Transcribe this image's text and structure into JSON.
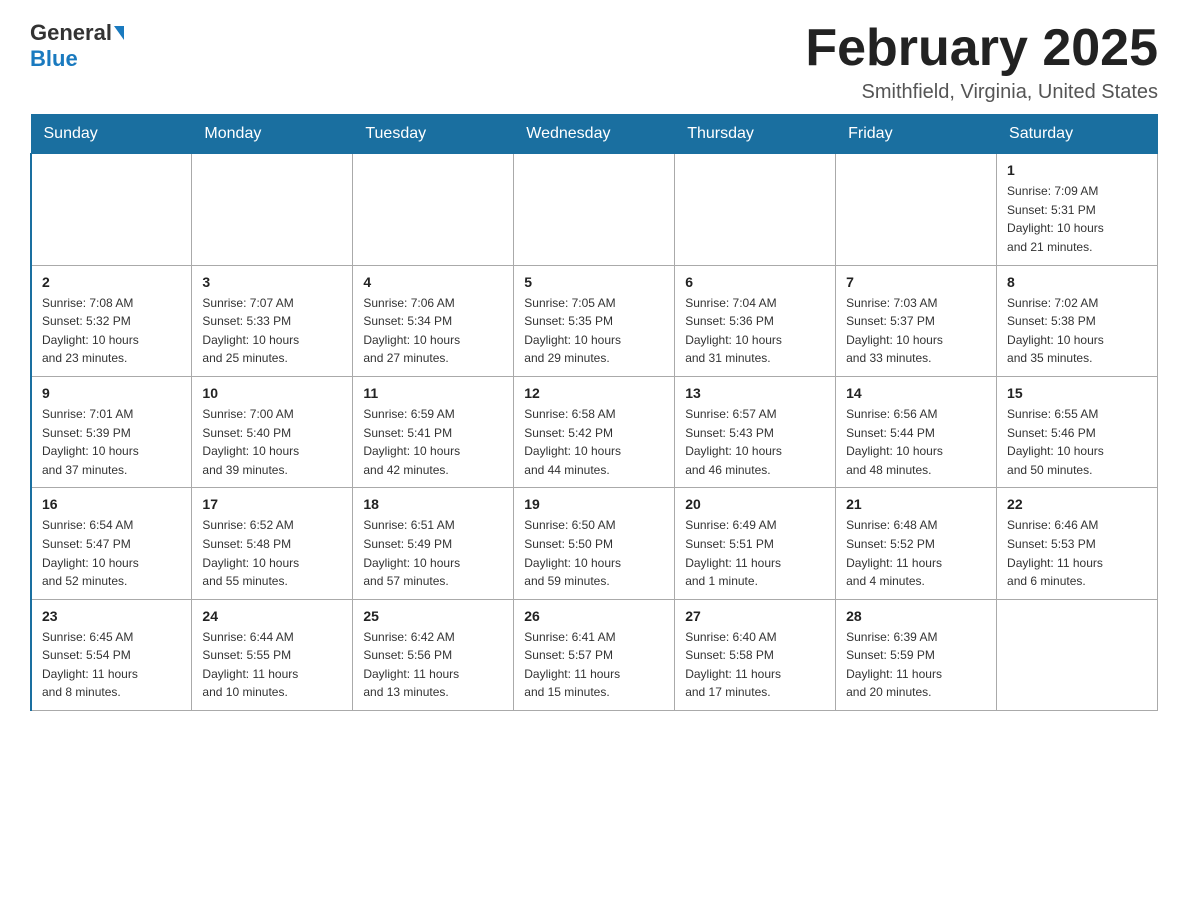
{
  "header": {
    "logo_general": "General",
    "logo_blue": "Blue",
    "month_title": "February 2025",
    "location": "Smithfield, Virginia, United States"
  },
  "days_of_week": [
    "Sunday",
    "Monday",
    "Tuesday",
    "Wednesday",
    "Thursday",
    "Friday",
    "Saturday"
  ],
  "weeks": [
    [
      {
        "day": "",
        "info": ""
      },
      {
        "day": "",
        "info": ""
      },
      {
        "day": "",
        "info": ""
      },
      {
        "day": "",
        "info": ""
      },
      {
        "day": "",
        "info": ""
      },
      {
        "day": "",
        "info": ""
      },
      {
        "day": "1",
        "info": "Sunrise: 7:09 AM\nSunset: 5:31 PM\nDaylight: 10 hours\nand 21 minutes."
      }
    ],
    [
      {
        "day": "2",
        "info": "Sunrise: 7:08 AM\nSunset: 5:32 PM\nDaylight: 10 hours\nand 23 minutes."
      },
      {
        "day": "3",
        "info": "Sunrise: 7:07 AM\nSunset: 5:33 PM\nDaylight: 10 hours\nand 25 minutes."
      },
      {
        "day": "4",
        "info": "Sunrise: 7:06 AM\nSunset: 5:34 PM\nDaylight: 10 hours\nand 27 minutes."
      },
      {
        "day": "5",
        "info": "Sunrise: 7:05 AM\nSunset: 5:35 PM\nDaylight: 10 hours\nand 29 minutes."
      },
      {
        "day": "6",
        "info": "Sunrise: 7:04 AM\nSunset: 5:36 PM\nDaylight: 10 hours\nand 31 minutes."
      },
      {
        "day": "7",
        "info": "Sunrise: 7:03 AM\nSunset: 5:37 PM\nDaylight: 10 hours\nand 33 minutes."
      },
      {
        "day": "8",
        "info": "Sunrise: 7:02 AM\nSunset: 5:38 PM\nDaylight: 10 hours\nand 35 minutes."
      }
    ],
    [
      {
        "day": "9",
        "info": "Sunrise: 7:01 AM\nSunset: 5:39 PM\nDaylight: 10 hours\nand 37 minutes."
      },
      {
        "day": "10",
        "info": "Sunrise: 7:00 AM\nSunset: 5:40 PM\nDaylight: 10 hours\nand 39 minutes."
      },
      {
        "day": "11",
        "info": "Sunrise: 6:59 AM\nSunset: 5:41 PM\nDaylight: 10 hours\nand 42 minutes."
      },
      {
        "day": "12",
        "info": "Sunrise: 6:58 AM\nSunset: 5:42 PM\nDaylight: 10 hours\nand 44 minutes."
      },
      {
        "day": "13",
        "info": "Sunrise: 6:57 AM\nSunset: 5:43 PM\nDaylight: 10 hours\nand 46 minutes."
      },
      {
        "day": "14",
        "info": "Sunrise: 6:56 AM\nSunset: 5:44 PM\nDaylight: 10 hours\nand 48 minutes."
      },
      {
        "day": "15",
        "info": "Sunrise: 6:55 AM\nSunset: 5:46 PM\nDaylight: 10 hours\nand 50 minutes."
      }
    ],
    [
      {
        "day": "16",
        "info": "Sunrise: 6:54 AM\nSunset: 5:47 PM\nDaylight: 10 hours\nand 52 minutes."
      },
      {
        "day": "17",
        "info": "Sunrise: 6:52 AM\nSunset: 5:48 PM\nDaylight: 10 hours\nand 55 minutes."
      },
      {
        "day": "18",
        "info": "Sunrise: 6:51 AM\nSunset: 5:49 PM\nDaylight: 10 hours\nand 57 minutes."
      },
      {
        "day": "19",
        "info": "Sunrise: 6:50 AM\nSunset: 5:50 PM\nDaylight: 10 hours\nand 59 minutes."
      },
      {
        "day": "20",
        "info": "Sunrise: 6:49 AM\nSunset: 5:51 PM\nDaylight: 11 hours\nand 1 minute."
      },
      {
        "day": "21",
        "info": "Sunrise: 6:48 AM\nSunset: 5:52 PM\nDaylight: 11 hours\nand 4 minutes."
      },
      {
        "day": "22",
        "info": "Sunrise: 6:46 AM\nSunset: 5:53 PM\nDaylight: 11 hours\nand 6 minutes."
      }
    ],
    [
      {
        "day": "23",
        "info": "Sunrise: 6:45 AM\nSunset: 5:54 PM\nDaylight: 11 hours\nand 8 minutes."
      },
      {
        "day": "24",
        "info": "Sunrise: 6:44 AM\nSunset: 5:55 PM\nDaylight: 11 hours\nand 10 minutes."
      },
      {
        "day": "25",
        "info": "Sunrise: 6:42 AM\nSunset: 5:56 PM\nDaylight: 11 hours\nand 13 minutes."
      },
      {
        "day": "26",
        "info": "Sunrise: 6:41 AM\nSunset: 5:57 PM\nDaylight: 11 hours\nand 15 minutes."
      },
      {
        "day": "27",
        "info": "Sunrise: 6:40 AM\nSunset: 5:58 PM\nDaylight: 11 hours\nand 17 minutes."
      },
      {
        "day": "28",
        "info": "Sunrise: 6:39 AM\nSunset: 5:59 PM\nDaylight: 11 hours\nand 20 minutes."
      },
      {
        "day": "",
        "info": ""
      }
    ]
  ]
}
